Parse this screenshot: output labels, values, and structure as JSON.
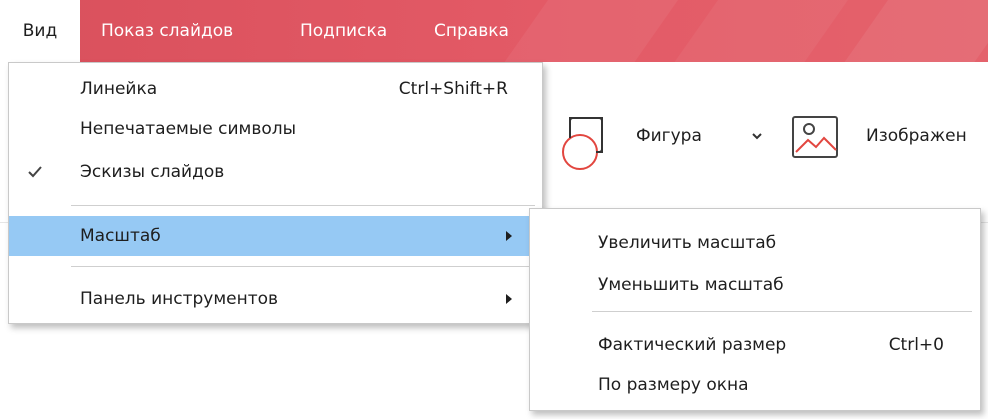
{
  "menubar": {
    "items": [
      {
        "label": "Вид",
        "active": true
      },
      {
        "label": "Показ слайдов",
        "active": false
      },
      {
        "label": "Подписка",
        "active": false
      },
      {
        "label": "Справка",
        "active": false
      }
    ],
    "accent": "#e35a66"
  },
  "toolbar": {
    "shape_label": "Фигура",
    "image_label": "Изображен"
  },
  "view_menu": {
    "items": [
      {
        "label": "Линейка",
        "shortcut": "Ctrl+Shift+R",
        "checked": false
      },
      {
        "label": "Непечатаемые символы",
        "checked": false
      },
      {
        "label": "Эскизы слайдов",
        "checked": true
      },
      {
        "label": "Масштаб",
        "submenu": true,
        "highlighted": true
      },
      {
        "label": "Панель инструментов",
        "submenu": true
      }
    ],
    "highlight_color": "#96c9f4"
  },
  "zoom_submenu": {
    "items": [
      {
        "label": "Увеличить масштаб"
      },
      {
        "label": "Уменьшить масштаб"
      },
      {
        "label": "Фактический размер",
        "shortcut": "Ctrl+0"
      },
      {
        "label": "По размеру окна"
      }
    ]
  },
  "icons": {
    "shape": "shape-icon",
    "chevron": "chevron-down-icon",
    "image": "image-icon",
    "check": "check-icon",
    "submenu_arrow": "submenu-arrow-icon"
  }
}
